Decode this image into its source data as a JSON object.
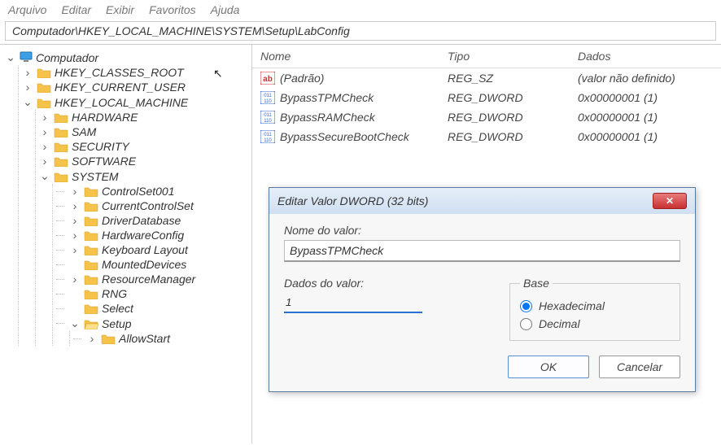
{
  "menubar": [
    "Arquivo",
    "Editar",
    "Exibir",
    "Favoritos",
    "Ajuda"
  ],
  "address": "Computador\\HKEY_LOCAL_MACHINE\\SYSTEM\\Setup\\LabConfig",
  "tree": {
    "root": "Computador",
    "hives": [
      "HKEY_CLASSES_ROOT",
      "HKEY_CURRENT_USER",
      "HKEY_LOCAL_MACHINE"
    ],
    "hklm": [
      "HARDWARE",
      "SAM",
      "SECURITY",
      "SOFTWARE",
      "SYSTEM"
    ],
    "system": [
      "ControlSet001",
      "CurrentControlSet",
      "DriverDatabase",
      "HardwareConfig",
      "Keyboard Layout",
      "MountedDevices",
      "ResourceManager",
      "RNG",
      "Select",
      "Setup"
    ],
    "setup_child": "AllowStart"
  },
  "columns": {
    "name": "Nome",
    "type": "Tipo",
    "data": "Dados"
  },
  "values": [
    {
      "icon": "str",
      "name": "(Padrão)",
      "type": "REG_SZ",
      "data": "(valor não definido)"
    },
    {
      "icon": "bin",
      "name": "BypassTPMCheck",
      "type": "REG_DWORD",
      "data": "0x00000001 (1)"
    },
    {
      "icon": "bin",
      "name": "BypassRAMCheck",
      "type": "REG_DWORD",
      "data": "0x00000001 (1)"
    },
    {
      "icon": "bin",
      "name": "BypassSecureBootCheck",
      "type": "REG_DWORD",
      "data": "0x00000001 (1)"
    }
  ],
  "dialog": {
    "title": "Editar Valor DWORD (32 bits)",
    "name_label": "Nome do valor:",
    "name_value": "BypassTPMCheck",
    "data_label": "Dados do valor:",
    "data_value": "1",
    "base_label": "Base",
    "hex": "Hexadecimal",
    "dec": "Decimal",
    "ok": "OK",
    "cancel": "Cancelar"
  }
}
